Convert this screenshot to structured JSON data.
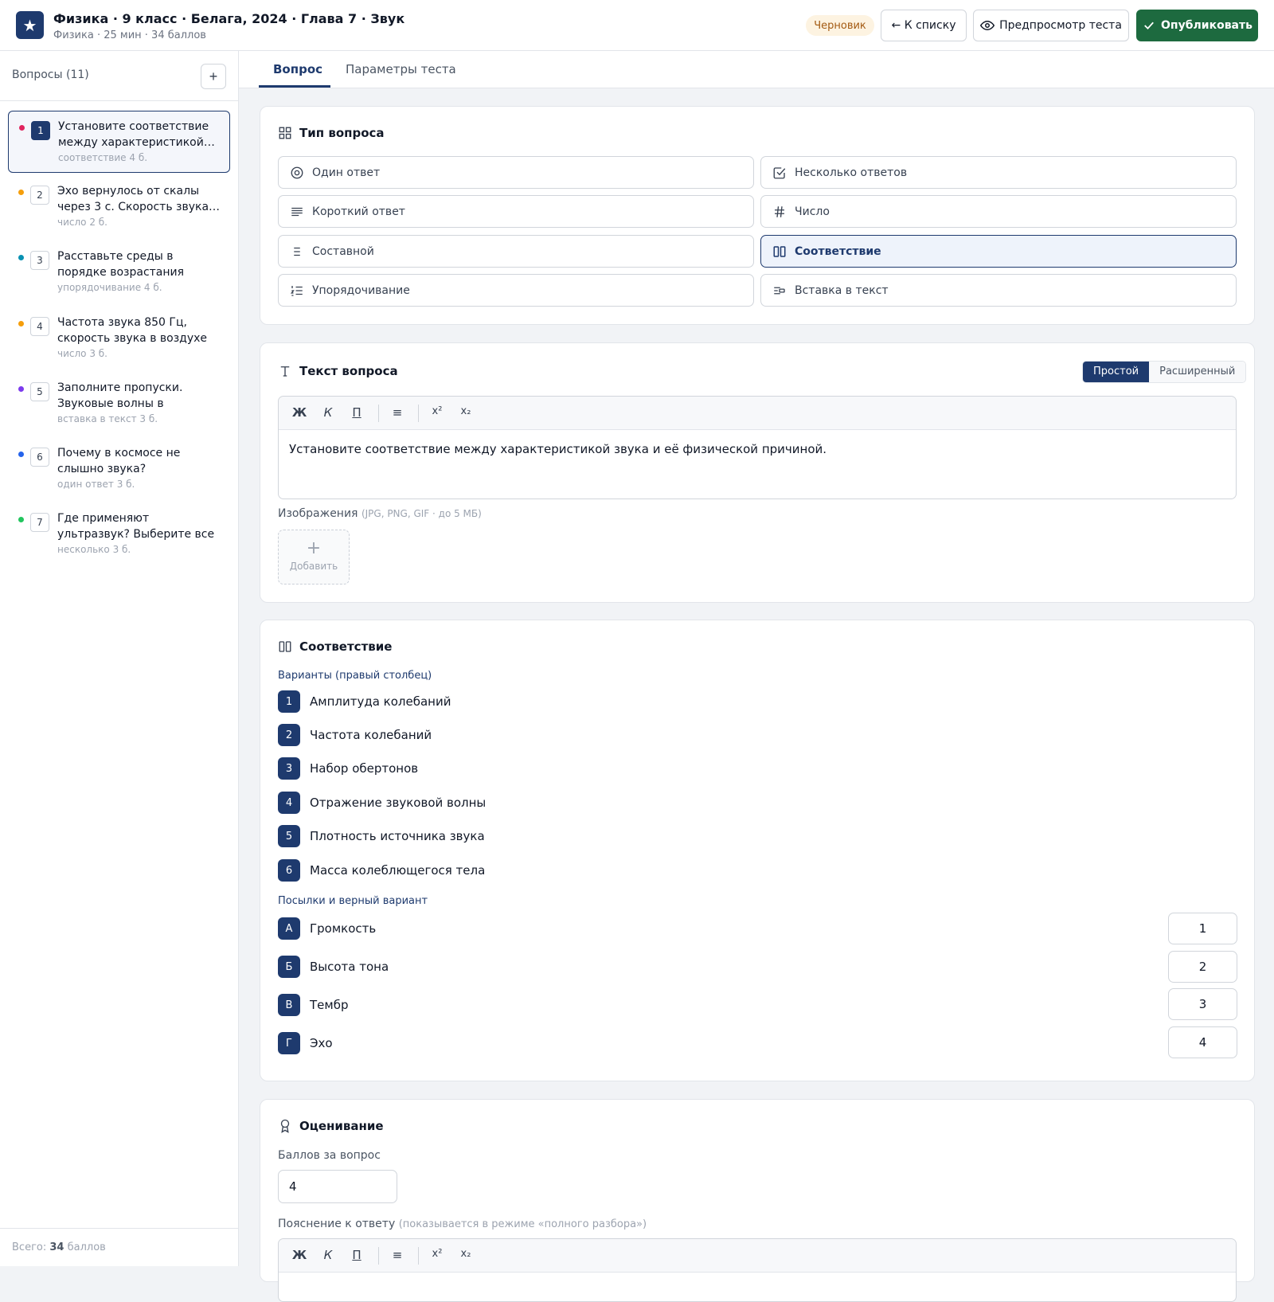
{
  "header": {
    "logo_glyph": "★",
    "title": "Физика · 9 класс · Белага, 2024 · Глава 7 · Звук",
    "subtitle": "Физика · 25 мин · 34 баллов",
    "status": "Черновик",
    "back_label": "← К списку",
    "preview_label": "Предпросмотр теста",
    "publish_label": "Опубликовать",
    "accent": "#1e3a6e",
    "publish_color": "#1d6a3f"
  },
  "sidebar": {
    "title": "Вопросы (11)",
    "add_label": "+",
    "items": [
      {
        "num": "1",
        "text": "Установите соответствие между характеристикой…",
        "meta": "соответствие  4 б.",
        "dot": "#e0245e"
      },
      {
        "num": "2",
        "text": "Эхо вернулось от скалы через 3 с. Скорость звука…",
        "meta": "число  2 б.",
        "dot": "#f59e0b"
      },
      {
        "num": "3",
        "text": "Расставьте среды в порядке возрастания скорости звука.",
        "meta": "упорядочивание  4 б.",
        "dot": "#0891b2"
      },
      {
        "num": "4",
        "text": "Частота звука 850 Гц, скорость звука в воздухе …",
        "meta": "число  3 б.",
        "dot": "#f59e0b"
      },
      {
        "num": "5",
        "text": "Заполните пропуски. Звуковые волны в воздухе…",
        "meta": "вставка в текст  3 б.",
        "dot": "#7c3aed"
      },
      {
        "num": "6",
        "text": "Почему в космосе не слышно звука?",
        "meta": "один ответ  3 б.",
        "dot": "#2563eb"
      },
      {
        "num": "7",
        "text": "Где применяют ультразвук? Выберите все верные…",
        "meta": "несколько  3 б.",
        "dot": "#22c55e"
      }
    ],
    "total_prefix": "Всего: ",
    "total_value": "34",
    "total_suffix": " баллов"
  },
  "tabs": [
    {
      "label": "Вопрос",
      "active": true
    },
    {
      "label": "Параметры теста",
      "active": false
    }
  ],
  "question_type": {
    "heading": "Тип вопроса",
    "options": [
      {
        "label": "Один ответ",
        "icon": "radio-icon"
      },
      {
        "label": "Несколько ответов",
        "icon": "checkbox-icon"
      },
      {
        "label": "Короткий ответ",
        "icon": "lines-icon"
      },
      {
        "label": "Число",
        "icon": "hash-icon"
      },
      {
        "label": "Составной",
        "icon": "list-icon"
      },
      {
        "label": "Соответствие",
        "icon": "columns-icon",
        "selected": true
      },
      {
        "label": "Упорядочивание",
        "icon": "ordered-list-icon"
      },
      {
        "label": "Вставка в текст",
        "icon": "insert-text-icon"
      }
    ]
  },
  "question_text": {
    "heading": "Текст вопроса",
    "mode_simple": "Простой",
    "mode_advanced": "Расширенный",
    "toolbar": {
      "bold": "Ж",
      "italic": "К",
      "underline": "П",
      "list": "≡",
      "sup": "x²",
      "sub": "x₂"
    },
    "content": "Установите соответствие между характеристикой звука и её физической причиной.",
    "images_label": "Изображения",
    "images_hint": "(JPG, PNG, GIF · до 5 МБ)",
    "add_image_label": "Добавить",
    "add_image_glyph": "+"
  },
  "matching": {
    "heading": "Соответствие",
    "options_label": "Варианты (правый столбец)",
    "options": [
      {
        "key": "1",
        "text": "Амплитуда колебаний"
      },
      {
        "key": "2",
        "text": "Частота колебаний"
      },
      {
        "key": "3",
        "text": "Набор обертонов"
      },
      {
        "key": "4",
        "text": "Отражение звуковой волны"
      },
      {
        "key": "5",
        "text": "Плотность источника звука"
      },
      {
        "key": "6",
        "text": "Масса колеблющегося тела"
      }
    ],
    "premises_label": "Посылки и верный вариант",
    "premises": [
      {
        "key": "А",
        "text": "Громкость",
        "answer": "1"
      },
      {
        "key": "Б",
        "text": "Высота тона",
        "answer": "2"
      },
      {
        "key": "В",
        "text": "Тембр",
        "answer": "3"
      },
      {
        "key": "Г",
        "text": "Эхо",
        "answer": "4"
      }
    ]
  },
  "scoring": {
    "heading": "Оценивание",
    "points_label": "Баллов за вопрос",
    "points_value": "4",
    "explanation_label": "Пояснение к ответу",
    "explanation_hint": "(показывается в режиме «полного разбора»)",
    "toolbar": {
      "bold": "Ж",
      "italic": "К",
      "underline": "П",
      "list": "≡",
      "sup": "x²",
      "sub": "x₂"
    }
  }
}
